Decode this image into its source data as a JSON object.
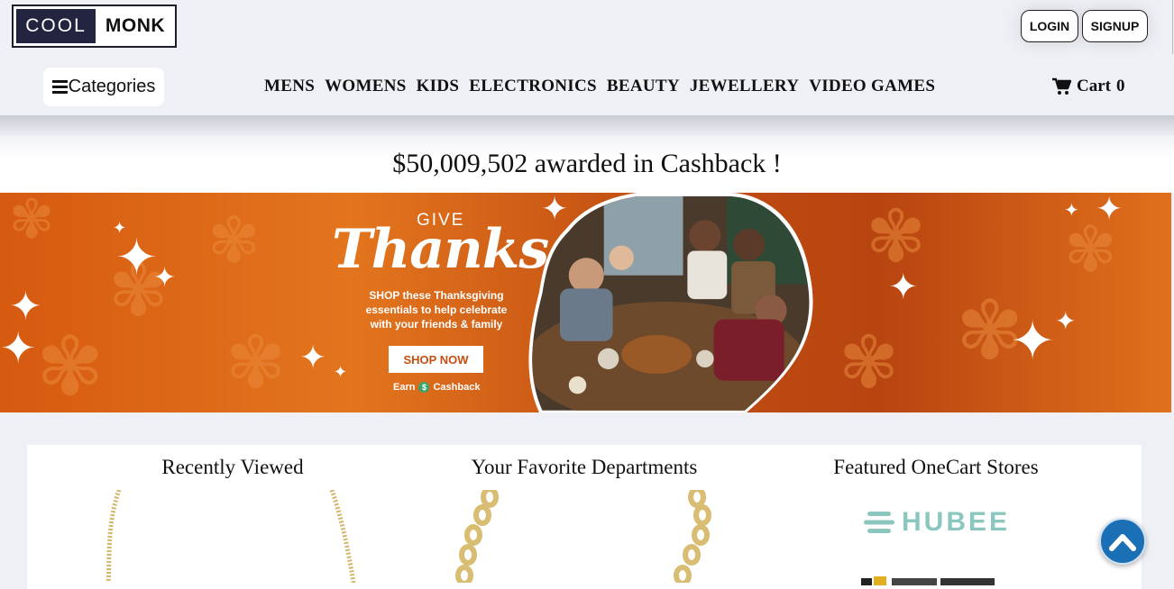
{
  "header": {
    "logo_left": "COOL",
    "logo_right": "MONK",
    "login_label": "LOGIN",
    "signup_label": "SIGNUP"
  },
  "nav": {
    "categories_label": "Categories",
    "items": [
      "MENS",
      "WOMENS",
      "KIDS",
      "ELECTRONICS",
      "BEAUTY",
      "JEWELLERY",
      "VIDEO GAMES"
    ],
    "cart_label": "Cart",
    "cart_count": "0"
  },
  "cashback_banner": "$50,009,502 awarded in Cashback !",
  "promo": {
    "give": "GIVE",
    "thanks": "Thanks",
    "text": "SHOP these Thanksgiving essentials to help celebrate with your friends & family",
    "cta": "SHOP NOW",
    "earn": "Earn",
    "cashback": "Cashback"
  },
  "sections": {
    "recent": "Recently Viewed",
    "departments": "Your Favorite Departments",
    "stores": "Featured OneCart Stores"
  },
  "stores": {
    "hubee": "HUBEE"
  },
  "colors": {
    "brand_dark": "#23243f",
    "banner_orange": "#d65a10",
    "hubee_teal": "#8cc7bf",
    "to_top_blue": "#1b6fb5"
  }
}
